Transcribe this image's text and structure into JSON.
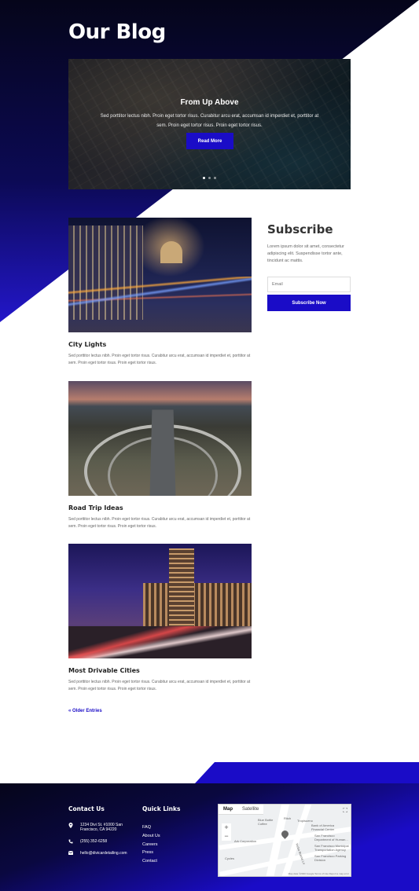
{
  "page": {
    "title": "Our Blog"
  },
  "slider": {
    "title": "From Up Above",
    "text": "Sed porttitor lectus nibh. Proin eget tortor risus. Curabitur arcu erat, accumsan id imperdiet et, porttitor at sem. Proin eget tortor risus. Proin eget tortor risus.",
    "button_label": "Read More",
    "slide_count": 3,
    "active_slide": 1
  },
  "posts": [
    {
      "title": "City Lights",
      "excerpt": "Sed porttitor lectus nibh. Proin eget tortor risus. Curabitur arcu erat, accumsan id imperdiet et, porttitor at sem. Proin eget tortor risus. Proin eget tortor risus."
    },
    {
      "title": "Road Trip Ideas",
      "excerpt": "Sed porttitor lectus nibh. Proin eget tortor risus. Curabitur arcu erat, accumsan id imperdiet et, porttitor at sem. Proin eget tortor risus. Proin eget tortor risus."
    },
    {
      "title": "Most Drivable Cities",
      "excerpt": "Sed porttitor lectus nibh. Proin eget tortor risus. Curabitur arcu erat, accumsan id imperdiet et, porttitor at sem. Proin eget tortor risus. Proin eget tortor risus."
    }
  ],
  "pagination": {
    "older_label": "« Older Entries"
  },
  "subscribe": {
    "title": "Subscribe",
    "text": "Lorem ipsum dolor sit amet, consectetur adipiscing elit. Suspendisse tortor ante, tincidunt ac mattis.",
    "email_placeholder": "Email",
    "button_label": "Subscribe Now"
  },
  "footer": {
    "contact_heading": "Contact Us",
    "address": "1234 Divi St. #1000 San Francisco, CA 94220",
    "phone": "(255) 352-6258",
    "email": "hello@divicardetailing.com",
    "links_heading": "Quick Links",
    "links": [
      "FAQ",
      "About Us",
      "Careers",
      "Press",
      "Contact"
    ]
  },
  "map": {
    "tabs": [
      "Map",
      "Satellite"
    ],
    "labels": [
      "Bank of America Financial Center",
      "San Francisco Department of Human...",
      "San Francisco Municipal Transportation Agency",
      "San Francisco Parking Division",
      "Ark Corporation",
      "Yerba Buena Ln",
      "Ritch",
      "Blue Bottle Coffee",
      "Tropisueno",
      "Cycles"
    ],
    "attribution": "Map data ©2020 Google   Terms of Use   Report a map error"
  },
  "colors": {
    "accent": "#1a0cc7",
    "dark": "#05051a"
  }
}
